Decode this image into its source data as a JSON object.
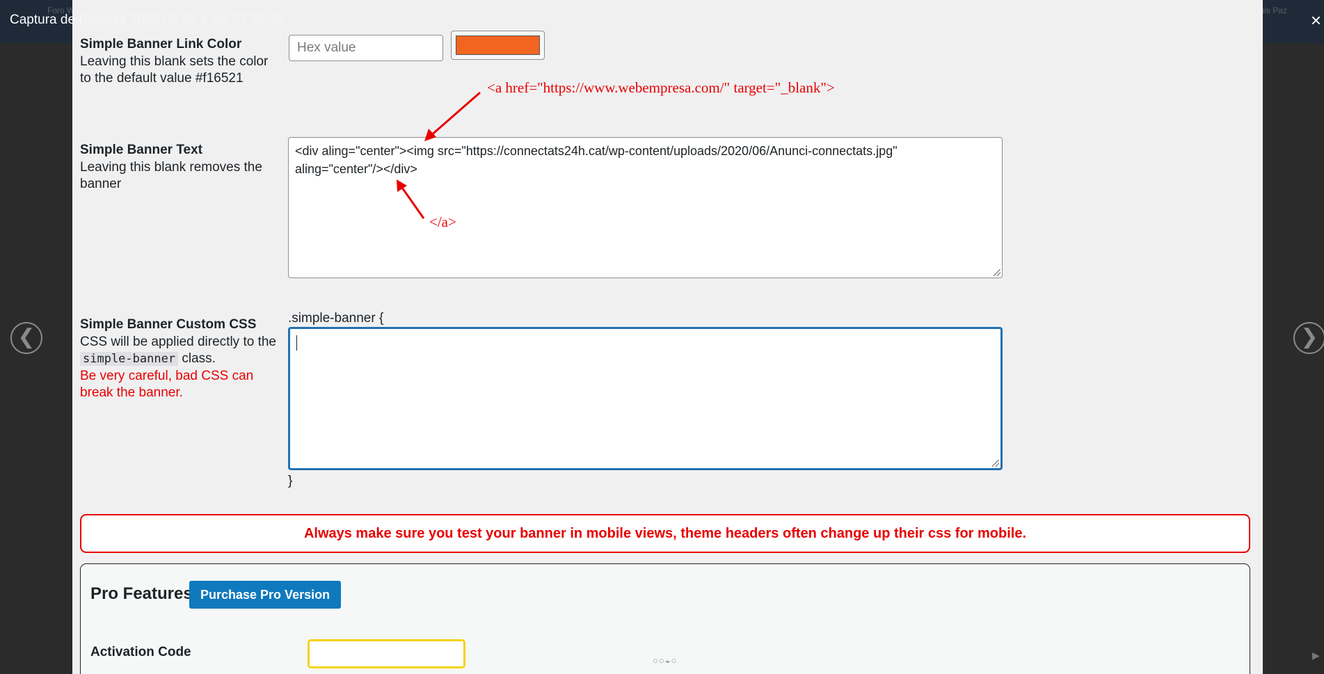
{
  "overlay": {
    "title_visible": "Captura de",
    "title_faded": " Pantalla 2020 06 09 a les 23.38.35",
    "close_glyph": "×",
    "prev_glyph": "❮",
    "next_glyph": "❯",
    "play_glyph": "▶",
    "topbar_left_faint": "Foro W",
    "topbar_right_faint": "luis Paz"
  },
  "link_color": {
    "title": "Simple Banner Link Color",
    "description": "Leaving this blank sets the color to the default value #f16521",
    "placeholder": "Hex value",
    "swatch_color": "#f16521"
  },
  "banner_text": {
    "title": "Simple Banner Text",
    "description": "Leaving this blank removes the banner",
    "line1": "<div aling=\"center\"><img src=\"https://connectats24h.cat/wp-content/uploads/2020/06/Anunci-connectats.jpg\"",
    "line2": "aling=\"center\"/></div>"
  },
  "custom_css": {
    "title": "Simple Banner Custom CSS",
    "desc_before": "CSS will be applied directly to the",
    "class_name": "simple-banner",
    "desc_after": "class.",
    "warning": "Be very careful, bad CSS can break the banner.",
    "prefix": ".simple-banner {",
    "suffix": "}"
  },
  "notice": "Always make sure you test your banner in mobile views, theme headers often change up their css for mobile.",
  "pro": {
    "title": "Pro Features",
    "button_label": "Purchase Pro Version",
    "activation_label": "Activation Code",
    "indicator": "○○◒○"
  },
  "annotations": {
    "open_tag": "<a href=\"https://www.webempresa.com/\" target=\"_blank\">",
    "close_tag": "</a>",
    "color": "#e80000"
  }
}
